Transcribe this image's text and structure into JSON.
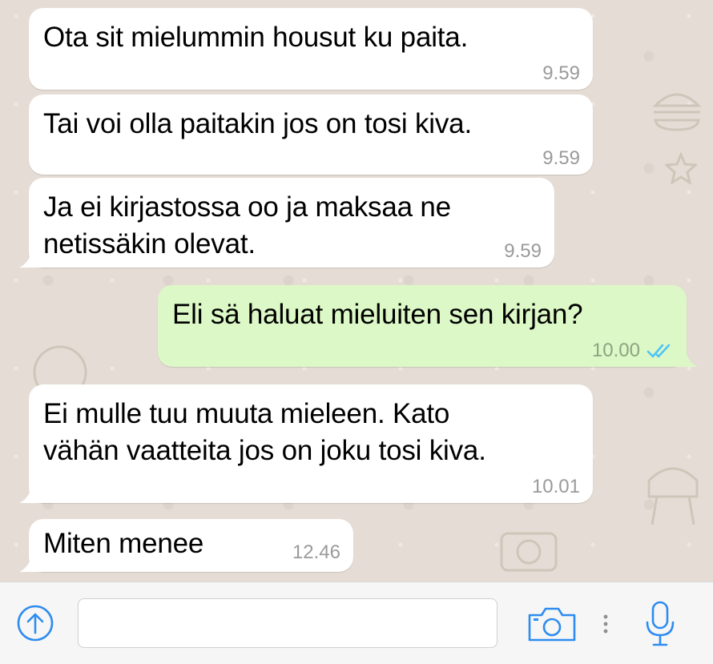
{
  "messages": [
    {
      "direction": "in",
      "text": "Ota sit mielummin housut ku paita.",
      "time": "9.59"
    },
    {
      "direction": "in",
      "text": "Tai voi olla paitakin jos on tosi kiva.",
      "time": "9.59"
    },
    {
      "direction": "in",
      "text_line1": "Ja ei kirjastossa oo ja maksaa ne",
      "text_line2": "netissäkin olevat.",
      "time": "9.59"
    },
    {
      "direction": "out",
      "text": "Eli sä haluat mieluiten sen kirjan?",
      "time": "10.00",
      "status": "read"
    },
    {
      "direction": "in",
      "text_line1": "Ei mulle tuu muuta mieleen. Kato",
      "text_line2": "vähän vaatteita jos on joku tosi kiva.",
      "time": "10.01"
    },
    {
      "direction": "in",
      "text": "Miten menee",
      "time": "12.46"
    }
  ],
  "composer": {
    "input_value": "",
    "icons": [
      "upload-arrow-icon",
      "camera-icon",
      "more-vertical-icon",
      "microphone-icon"
    ]
  },
  "colors": {
    "chat_background": "#e5ddd5",
    "incoming_bubble": "#ffffff",
    "outgoing_bubble": "#dcf8c6",
    "accent_blue": "#2d8cf0",
    "read_ticks": "#4fc3f7"
  }
}
